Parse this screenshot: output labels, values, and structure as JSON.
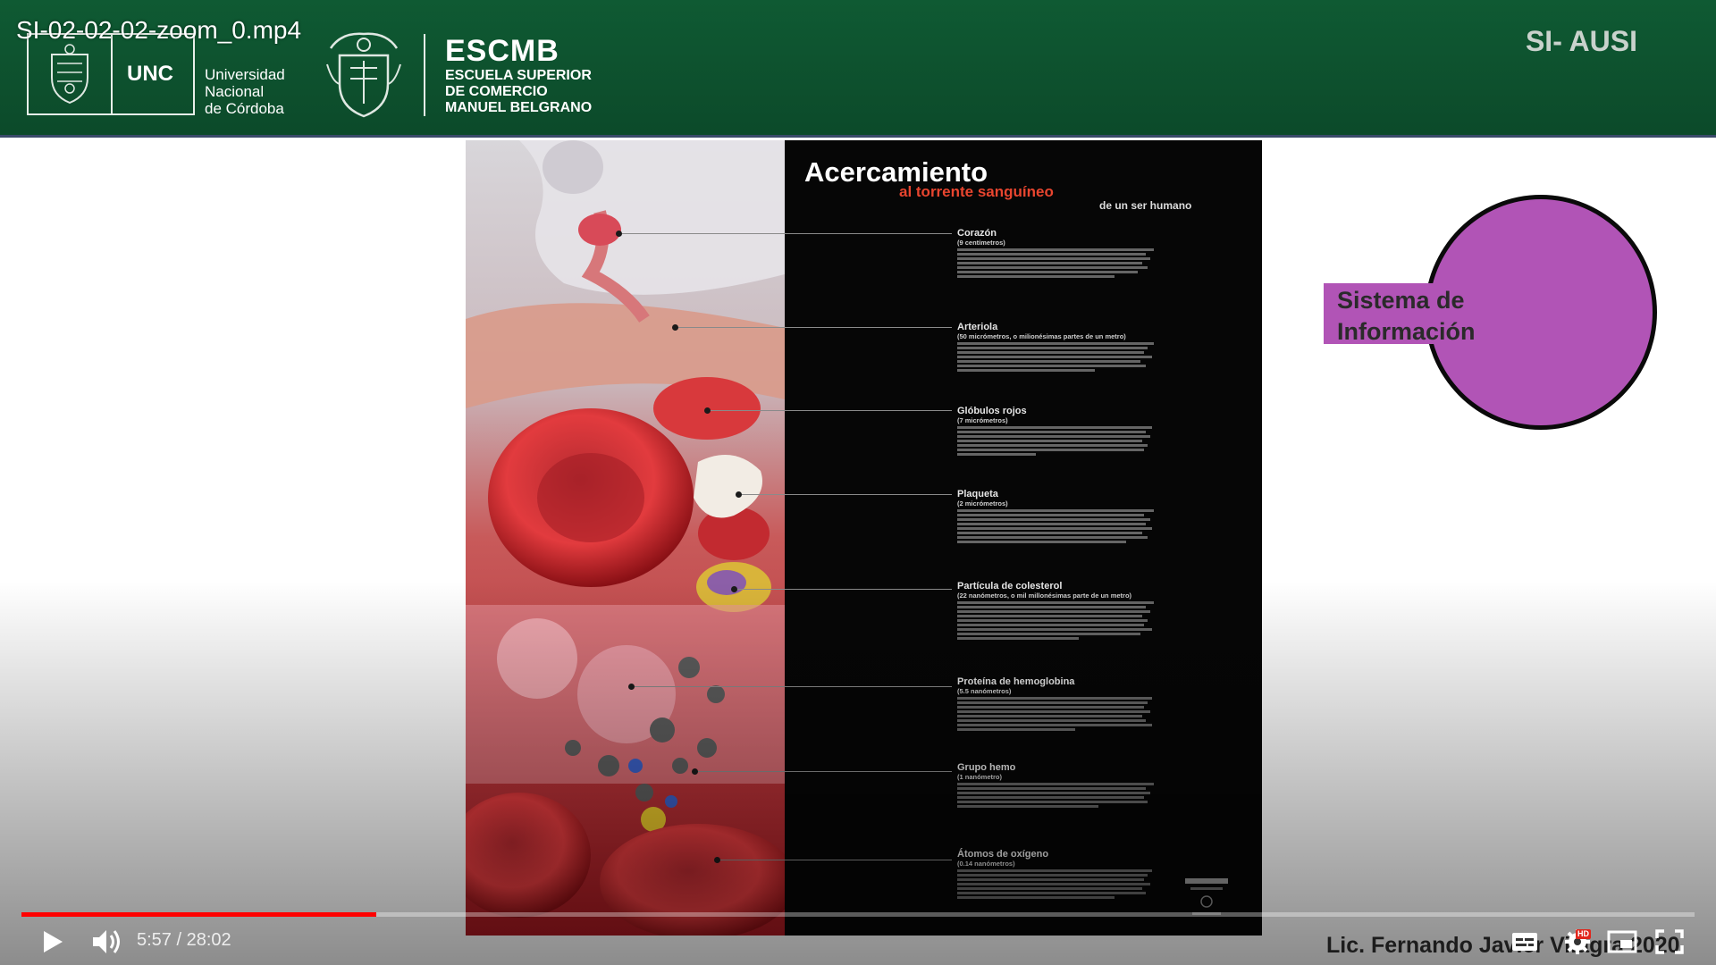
{
  "video": {
    "file_title": "SI-02-02-02-zoom_0.mp4",
    "current_time": "5:57",
    "duration": "28:02",
    "time_separator": " / ",
    "progress_fraction": 0.212
  },
  "banner": {
    "unc_label": "UNC",
    "unc_name_lines": [
      "Universidad",
      "Nacional",
      "de Córdoba"
    ],
    "escmb_title": "ESCMB",
    "escmb_subtitle_lines": [
      "ESCUELA SUPERIOR",
      "DE COMERCIO",
      "MANUEL BELGRANO"
    ],
    "course_code": "SI- AUSI",
    "background_color": "#0f5a33"
  },
  "poster": {
    "title": "Acercamiento",
    "subtitle": "al torrente sanguíneo",
    "subtitle2": "de un ser humano",
    "accent_color": "#e8452f",
    "entries": [
      {
        "heading": "Corazón",
        "size": "(9 centímetros)"
      },
      {
        "heading": "Arteriola",
        "size": "(50 micrómetros, o milionésimas partes de un metro)"
      },
      {
        "heading": "Glóbulos rojos",
        "size": "(7 micrómetros)"
      },
      {
        "heading": "Plaqueta",
        "size": "(2 micrómetros)"
      },
      {
        "heading": "Partícula de colesterol",
        "size": "(22 nanómetros, o mil millonésimas parte de un metro)"
      },
      {
        "heading": "Proteína de hemoglobina",
        "size": "(5.5 nanómetros)"
      },
      {
        "heading": "Grupo hemo",
        "size": "(1 nanómetro)"
      },
      {
        "heading": "Átomos de oxígeno",
        "size": "(0.14 nanómetros)"
      }
    ]
  },
  "diagram": {
    "label_lines": [
      "Sistema de",
      "Información"
    ],
    "fill_color": "#b154b6"
  },
  "author": "Lic. Fernando Javier Vilagra 2020",
  "controls": {
    "hd_label": "HD",
    "icons": [
      "play-icon",
      "volume-icon",
      "subtitles-icon",
      "settings-icon",
      "miniplayer-icon",
      "fullscreen-icon"
    ]
  }
}
